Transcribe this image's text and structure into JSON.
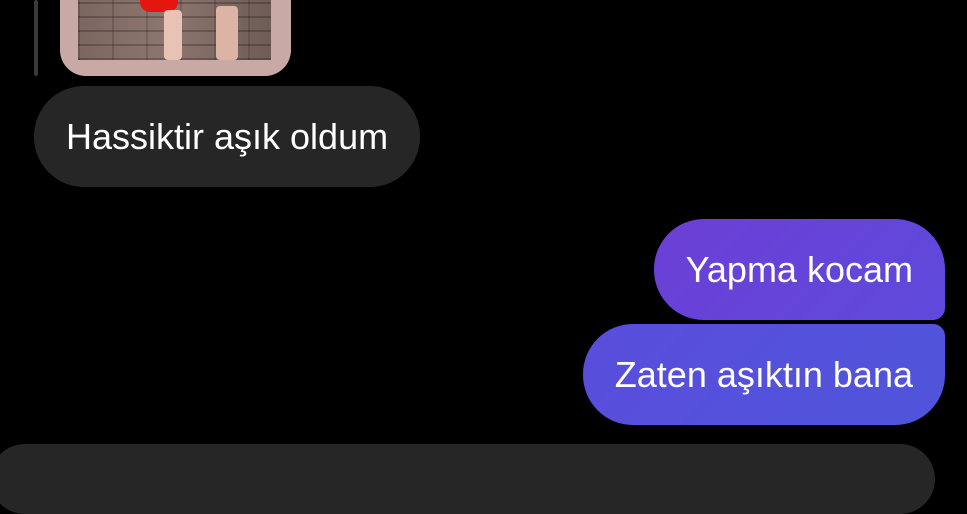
{
  "conversation": {
    "messages": [
      {
        "sender": "them",
        "text": "Hassiktir aşık oldum"
      },
      {
        "sender": "me",
        "text": "Yapma kocam"
      },
      {
        "sender": "me",
        "text": "Zaten aşıktın bana"
      }
    ]
  },
  "theme": {
    "background": "#000000",
    "incoming_bubble": "#262626",
    "outgoing_bubble_start": "#6c3fd6",
    "outgoing_bubble_end": "#4f55db",
    "text": "#ffffff"
  }
}
